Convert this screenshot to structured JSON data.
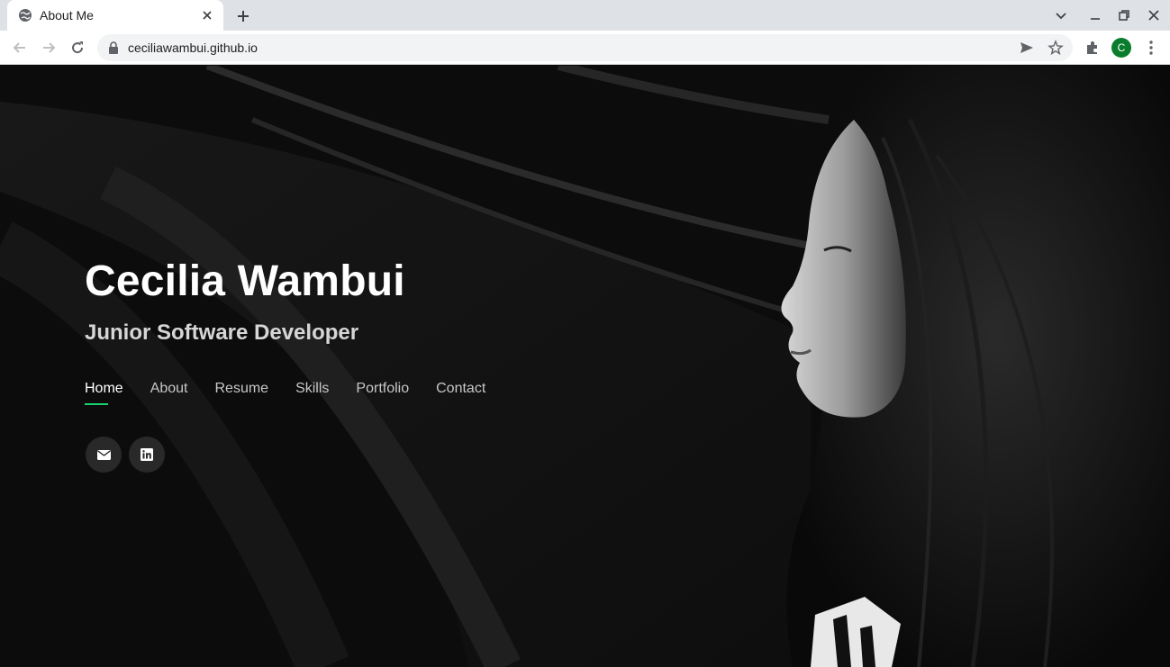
{
  "browser": {
    "tab_title": "About Me",
    "url": "ceciliawambui.github.io",
    "profile_initial": "C"
  },
  "hero": {
    "name": "Cecilia Wambui",
    "role": "Junior Software Developer"
  },
  "nav": {
    "items": [
      {
        "label": "Home",
        "active": true
      },
      {
        "label": "About"
      },
      {
        "label": "Resume"
      },
      {
        "label": "Skills"
      },
      {
        "label": "Portfolio"
      },
      {
        "label": "Contact"
      }
    ]
  },
  "social": {
    "icons": [
      "email-icon",
      "linkedin-icon"
    ]
  },
  "colors": {
    "accent": "#18d26e",
    "background": "#0c0c0c",
    "avatar": "#0a7d2c"
  }
}
